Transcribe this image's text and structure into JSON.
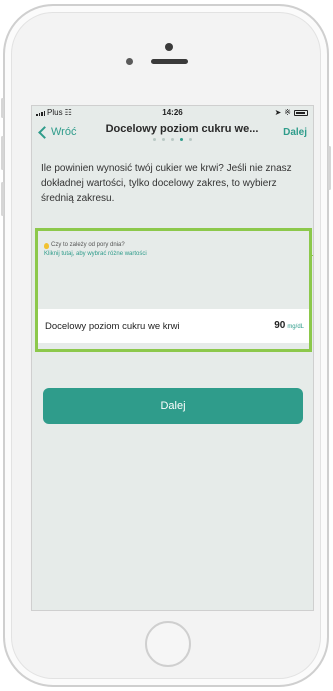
{
  "status": {
    "carrier": "Plus",
    "time": "14:26",
    "icons": [
      "signal-icon",
      "wifi-icon",
      "location-icon",
      "bluetooth-icon",
      "battery-icon"
    ]
  },
  "nav": {
    "back_label": "Wróć",
    "title": "Docelowy poziom cukru we...",
    "next_label": "Dalej",
    "step_count": 5,
    "active_step": 4
  },
  "question": "Ile powinien wynosić twój cukier we krwi? Jeśli nie znasz dokładnej wartości, tylko docelowy zakres, to wybierz średnią zakresu.",
  "tip": {
    "question": "Czy to zależy od pory dnia?",
    "link": "Kliknij tutaj, aby wybrać różne wartości"
  },
  "target_row": {
    "label": "Docelowy poziom cukru we krwi",
    "value": "90",
    "unit": "mg/dL"
  },
  "primary_button": "Dalej",
  "colors": {
    "accent": "#2f9c8b",
    "highlight": "#8cc84b",
    "screen_bg": "#e6ebe9"
  }
}
